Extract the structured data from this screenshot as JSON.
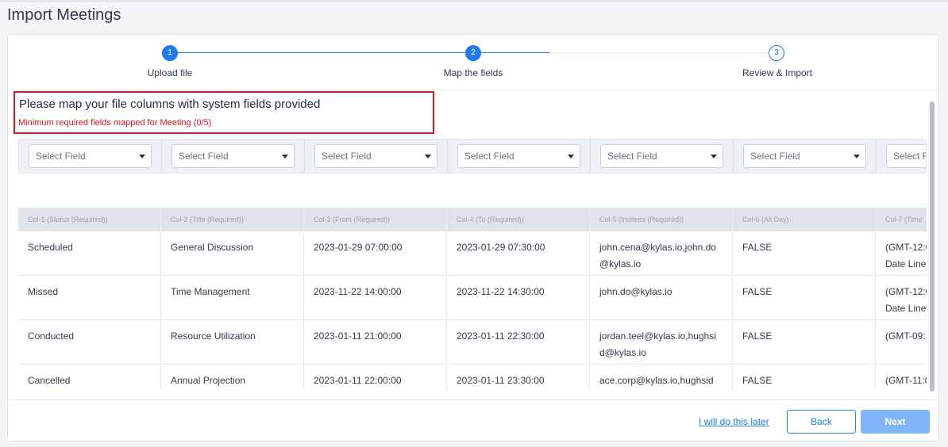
{
  "page": {
    "title": "Import Meetings"
  },
  "stepper": {
    "steps": [
      {
        "number": "1",
        "label": "Upload file",
        "state": "done"
      },
      {
        "number": "2",
        "label": "Map the fields",
        "state": "active"
      },
      {
        "number": "3",
        "label": "Review & Import",
        "state": "pending"
      }
    ]
  },
  "instructions": {
    "title": "Please map your file columns with system fields provided",
    "required_status": "Minimum required fields mapped for Meeting (0/5)"
  },
  "mapping": {
    "placeholder": "Select Field",
    "visible_selects": 7
  },
  "table": {
    "columns": [
      "Col-1 (Status (Required))",
      "Col-2 (Title (Required))",
      "Col-3 (From (Required))",
      "Col-4 (To (Required))",
      "Col-5 (Invitees (Required))",
      "Col-6 (All Day)",
      "Col-7 (Time"
    ],
    "rows": [
      {
        "cells": [
          "Scheduled",
          "General Discussion",
          "2023-01-29 07:00:00",
          "2023-01-29 07:30:00",
          "john.cena@kylas.io,john.do",
          "FALSE",
          "(GMT-12:0"
        ],
        "line2": [
          "",
          "",
          "",
          "",
          "@kylas.io",
          "",
          "Date Line"
        ]
      },
      {
        "cells": [
          "Missed",
          "Time Management",
          "2023-11-22 14:00:00",
          "2023-11-22 14:30:00",
          "john.do@kylas.io",
          "FALSE",
          "(GMT-12:0"
        ],
        "line2": [
          "",
          "",
          "",
          "",
          "",
          "",
          "Date Line"
        ]
      },
      {
        "cells": [
          "Conducted",
          "Resource Utilization",
          "2023-01-11 21:00:00",
          "2023-01-11 22:30:00",
          "jordan.teel@kylas.io,hughsi",
          "FALSE",
          "(GMT-09:"
        ],
        "line2": [
          "",
          "",
          "",
          "",
          "d@kylas.io",
          "",
          ""
        ]
      },
      {
        "cells": [
          "Cancelled",
          "Annual Projection",
          "2023-01-11 22:00:00",
          "2023-01-11 23:30:00",
          "ace.corp@kylas.io,hughsid",
          "FALSE",
          "(GMT-11:0"
        ],
        "line2": [
          "",
          "",
          "",
          "",
          "",
          "",
          ""
        ]
      }
    ]
  },
  "footer": {
    "later_link": "I will do this later",
    "back_label": "Back",
    "next_label": "Next"
  },
  "colors": {
    "accent": "#1e7bf0",
    "error": "#e0161e",
    "next_disabled": "#80b6f8"
  }
}
